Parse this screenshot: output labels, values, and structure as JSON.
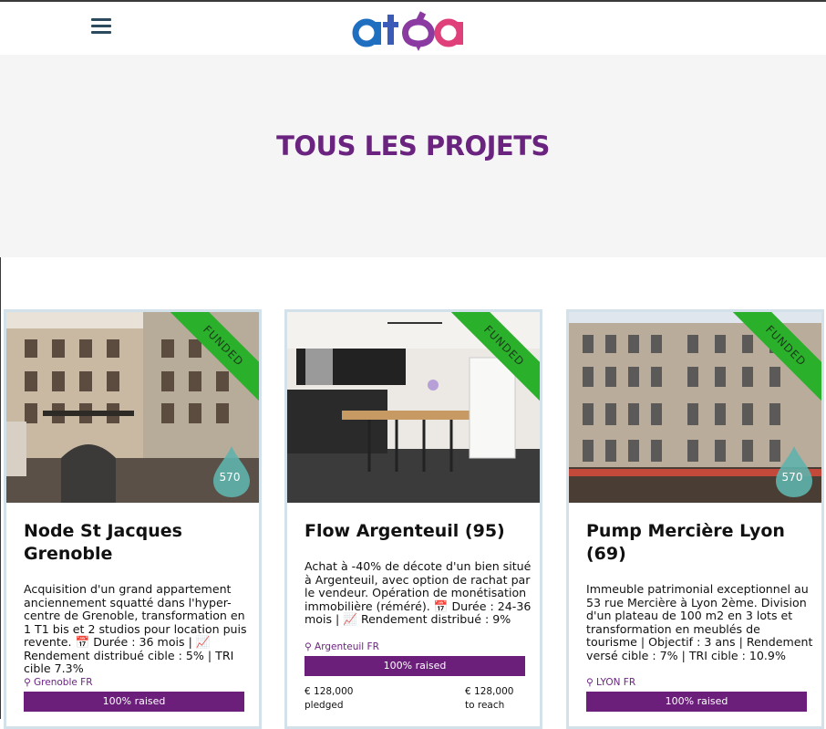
{
  "header": {
    "logo_text": "atoa",
    "menu_icon": "hamburger-menu-icon"
  },
  "hero": {
    "title": "TOUS LES PROJETS"
  },
  "colors": {
    "brand_purple": "#6b2380",
    "funded_green": "#2bb02b",
    "bar_purple": "#6b1f7a"
  },
  "projects": [
    {
      "title": "Node St Jacques Grenoble",
      "ribbon": "FUNDED",
      "badge": "570",
      "description": "Acquisition d'un grand appartement anciennement squatté dans l'hyper-centre de Grenoble, transformation en 1 T1 bis et 2 studios pour location puis revente. 📅 Durée : 36 mois | 📈 Rendement distribué cible : 5% | TRI cible 7.3%",
      "location": "Grenoble FR",
      "raised": "100% raised"
    },
    {
      "title": "Flow Argenteuil (95)",
      "ribbon": "FUNDED",
      "description": "Achat à -40% de décote d'un bien situé à Argenteuil, avec option de rachat par le vendeur. Opération de monétisation immobilière (réméré). 📅 Durée : 24-36 mois | 📈 Rendement distribué : 9%",
      "location": "Argenteuil FR",
      "raised": "100% raised",
      "pledged_amount": "€ 128,000",
      "pledged_label": "pledged",
      "reach_amount": "€ 128,000",
      "reach_label": "to reach"
    },
    {
      "title": "Pump Mercière Lyon (69)",
      "ribbon": "FUNDED",
      "badge": "570",
      "description": "Immeuble patrimonial exceptionnel au 53 rue Mercière à Lyon 2ème. Division d'un plateau de 100 m2 en 3 lots et transformation en meublés de tourisme | Objectif : 3 ans | Rendement versé cible : 7% | TRI cible : 10.9%",
      "location": "LYON FR",
      "raised": "100% raised"
    }
  ]
}
